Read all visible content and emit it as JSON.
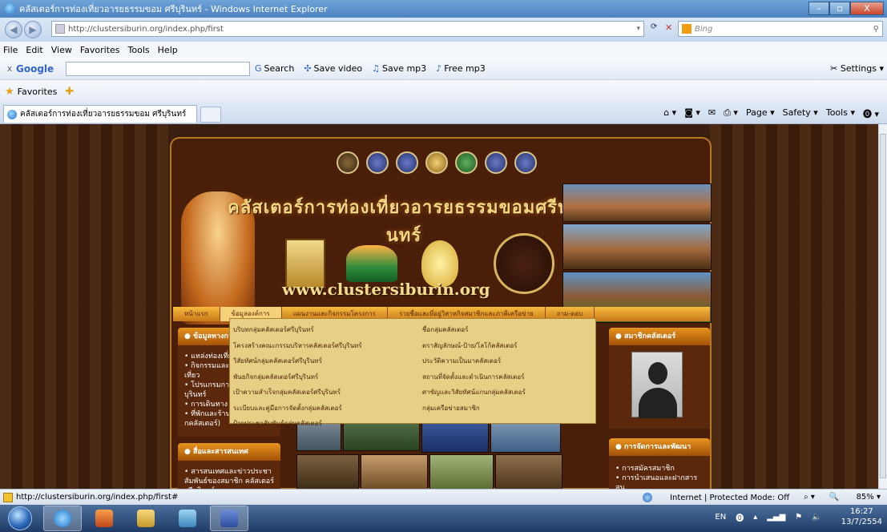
{
  "window": {
    "title": "คลัสเตอร์การท่องเที่ยวอารยธรรมขอม ศรีบุรินทร์ - Windows Internet Explorer",
    "min": "–",
    "max": "▫",
    "close": "X"
  },
  "address": {
    "url": "http://clustersiburin.org/index.php/first",
    "search_placeholder": "Bing"
  },
  "menu": [
    "File",
    "Edit",
    "View",
    "Favorites",
    "Tools",
    "Help"
  ],
  "google_toolbar": {
    "logo": "Google",
    "items": [
      {
        "icon": "search-icon",
        "label": "Search"
      },
      {
        "icon": "save-video-icon",
        "label": "Save video"
      },
      {
        "icon": "mp3-icon",
        "label": "Save mp3"
      },
      {
        "icon": "free-mp3-icon",
        "label": "Free mp3"
      }
    ],
    "settings": "Settings"
  },
  "favorites": {
    "label": "Favorites"
  },
  "tab": {
    "title": "คลัสเตอร์การท่องเที่ยวอารยธรรมขอม ศรีบุรินทร์"
  },
  "commands": [
    "Page ▾",
    "Safety ▾",
    "Tools ▾"
  ],
  "site": {
    "title": "คลัสเตอร์การท่องเที่ยวอารยธรรมขอมศรีบุรินทร์",
    "url": "www.clustersiburin.org",
    "nav": [
      "หน้าแรก",
      "ข้อมูลองค์การ",
      "แผนงานและกิจกรรมโครงการ",
      "รายชื่อและที่อยู่วิสาหกิจสมาชิกและภาคีเครือข่าย",
      "ถาม-ตอบ"
    ],
    "dropdown_left": [
      "บริบทกลุ่มคลัสเตอร์ศรีบุรินทร์",
      "โครงสร้างคณะกรรมบริหารคลัสเตอร์ศรีบุรินทร์",
      "วิสัยทัศน์กลุ่มคลัสเตอร์ศรีบุรินทร์",
      "พันธกิจกลุ่มคลัสเตอร์ศรีบุรินทร์",
      "เป้าความสำเร็จกลุ่มคลัสเตอร์ศรีบุรินทร์",
      "ระเบียบและคู่มือการจัดตั้งกลุ่มคลัสเตอร์",
      "ป้ายประชาสัมพันธ์กลุ่มคลัสเตอร์"
    ],
    "dropdown_right": [
      "ชื่อกลุ่มคลัสเตอร์",
      "ตราสัญลักษณ์-ป้าย/โลโก้คลัสเตอร์",
      "ประวัติความเป็นมาคลัสเตอร์",
      "สถานที่จัดตั้งและดำเนินการคลัสเตอร์",
      "ศาขัญและวิสัยทัศน์แกนกลุ่มคลัสเตอร์",
      "กลุ่มเครือข่ายสมาชิก"
    ],
    "left_box1": {
      "head": "ข้อมูลทางการ",
      "items": "• แหล่งท่องเที่ยว\n• กิจกรรมและป\n  เที่ยว\n• โปรแกรมการท\n  บุรินทร์\n• การเดินทาง\n• ที่พักและร้านอ\n  กคลัสเตอร์)"
    },
    "left_box2": {
      "head": "สื่อและสารสนเทศ",
      "items": "• สารสนเทศและข่าวประชา\n  สัมพันธ์ของสมาชิก คลัสเตอร์\n  ศรีบุรินทร์"
    },
    "right_box1": {
      "head": "สมาชิกคลัสเตอร์"
    },
    "right_box2": {
      "head": "การจัดการและพัฒนา",
      "items": "• การสมัครสมาชิก\n• การนำเสนอและฝากสารสน\n  เทศผ่านเว็บไซต์จาก\n  สมาชิก"
    }
  },
  "status": {
    "left": "http://clustersiburin.org/index.php/first#",
    "zone": "Internet | Protected Mode: Off",
    "zoom": "85%"
  },
  "taskbar": {
    "lang": "EN",
    "time": "16:27",
    "date": "13/7/2554"
  }
}
